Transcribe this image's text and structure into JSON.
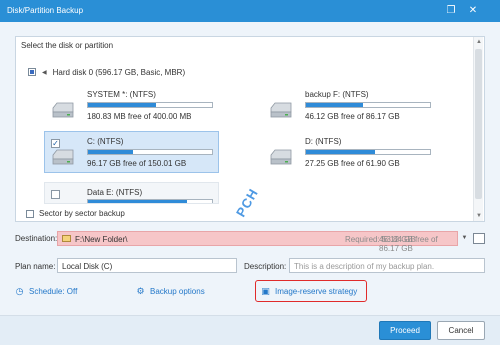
{
  "window": {
    "title": "Disk/Partition Backup",
    "colors": {
      "titlebar": "#2a8fd6",
      "accent": "#2f8bd8",
      "error_field": "#f6c6c8",
      "highlight": "#e02b2b"
    }
  },
  "disk_panel": {
    "label": "Select the disk or partition",
    "disk_header": "Hard disk 0 (596.17 GB, Basic, MBR)",
    "partitions": [
      {
        "name": "SYSTEM *: (NTFS)",
        "free": "180.83 MB free of 400.00 MB",
        "used_fraction": 0.55,
        "selected": false,
        "has_checkbox": false
      },
      {
        "name": "backup F: (NTFS)",
        "free": "46.12 GB free of 86.17 GB",
        "used_fraction": 0.46,
        "selected": false,
        "has_checkbox": false
      },
      {
        "name": "C: (NTFS)",
        "free": "96.17 GB free of 150.01 GB",
        "used_fraction": 0.36,
        "selected": true,
        "has_checkbox": true
      },
      {
        "name": "D: (NTFS)",
        "free": "27.25 GB free of 61.90 GB",
        "used_fraction": 0.56,
        "selected": false,
        "has_checkbox": false
      },
      {
        "name": "Data E: (NTFS)",
        "free": "",
        "used_fraction": 0.8,
        "selected": false,
        "has_checkbox": true
      }
    ]
  },
  "sector_by_sector": {
    "label": "Sector by sector backup",
    "checked": false
  },
  "destination": {
    "label": "Destination:",
    "path": "F:\\New Folder\\",
    "required": "Required: 53.84 GB",
    "free": "46.12 GB free of 86.17 GB"
  },
  "watermark": "PCH",
  "plan_name": {
    "label": "Plan name:",
    "value": "Local Disk (C)"
  },
  "description": {
    "label": "Description:",
    "placeholder": "This is a description of my backup plan."
  },
  "options": {
    "schedule": "Schedule: Off",
    "backup_options": "Backup options",
    "image_reserve": "Image-reserve strategy"
  },
  "buttons": {
    "proceed": "Proceed",
    "cancel": "Cancel"
  }
}
